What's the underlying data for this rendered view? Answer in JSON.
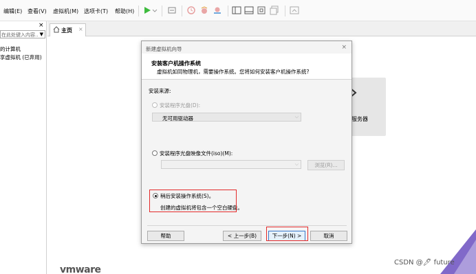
{
  "menubar": {
    "items": [
      "编辑(E)",
      "查看(V)",
      "虚拟机(M)",
      "选项卡(T)",
      "帮助(H)"
    ]
  },
  "library": {
    "close_glyph": "×",
    "search_placeholder": "在此处键入内容...",
    "items": [
      "的计算机",
      "享虚拟机 (已弃用)"
    ]
  },
  "tabs": {
    "home_label": "主页",
    "close_glyph": "×"
  },
  "home": {
    "tile_label": "服务器",
    "logo_text": "vmware"
  },
  "wizard": {
    "window_title": "新建虚拟机向导",
    "close_glyph": "×",
    "header_title": "安装客户机操作系统",
    "header_subtitle": "虚拟机如同物理机，需要操作系统。您将如何安装客户机操作系统?",
    "section_label": "安装来源:",
    "option_disc": "安装程序光盘(D):",
    "disc_select_value": "无可用驱动器",
    "option_iso": "安装程序光盘映像文件(iso)(M):",
    "iso_path_value": "",
    "browse_button": "浏览(R)...",
    "option_later": "稍后安装操作系统(S)。",
    "later_description": "创建的虚拟机将包含一个空白硬盘。",
    "selected_option": "later",
    "buttons": {
      "help": "帮助",
      "back": "< 上一步(B)",
      "next": "下一步(N) >",
      "cancel": "取消"
    }
  },
  "watermark": "CSDN @🖊 future",
  "colors": {
    "highlight_red": "#e32929",
    "play_green": "#3dbb3d"
  }
}
